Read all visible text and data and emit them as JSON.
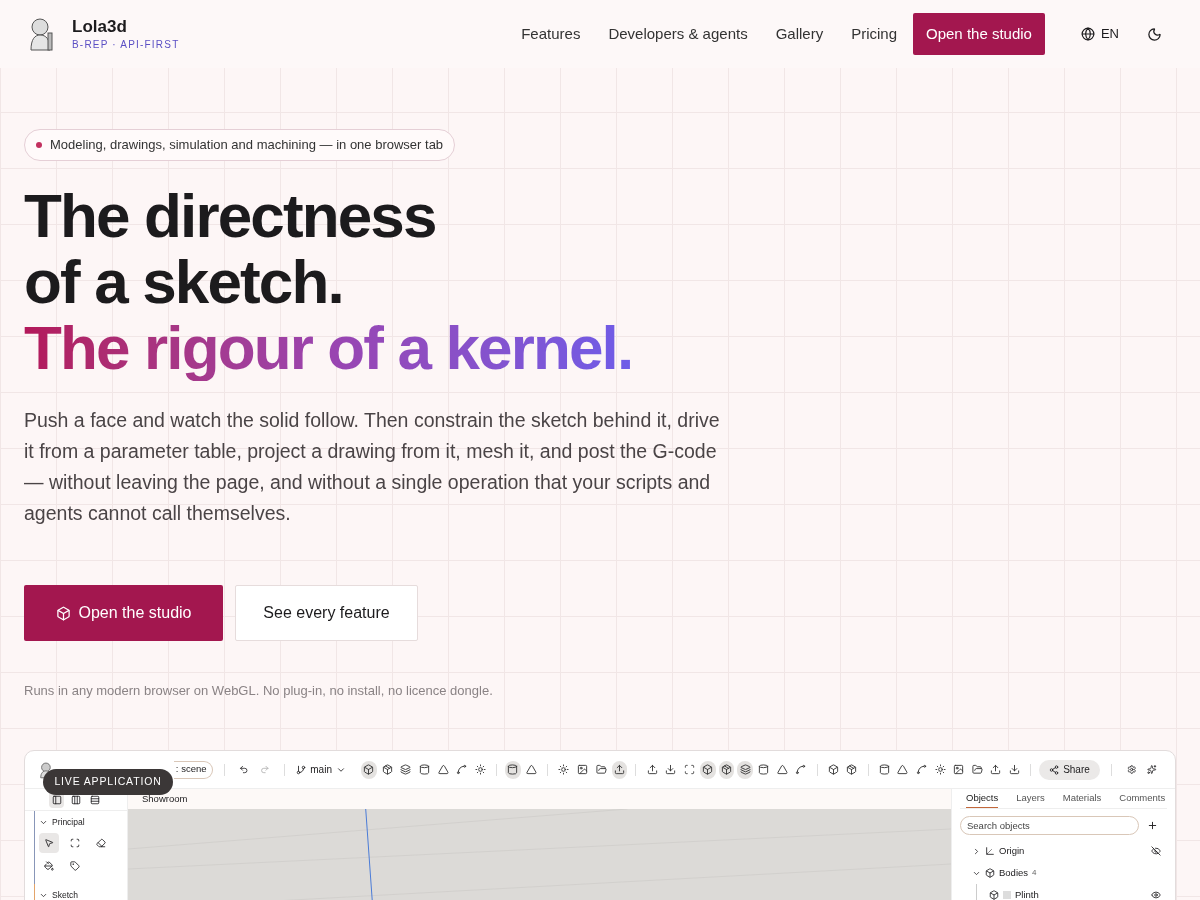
{
  "brand": {
    "name": "Lola3d",
    "tagline": "B-REP · API-FIRST"
  },
  "nav": {
    "links": [
      "Features",
      "Developers & agents",
      "Gallery",
      "Pricing"
    ],
    "cta": "Open the studio",
    "language": "EN"
  },
  "hero": {
    "pill": "Modeling, drawings, simulation and machining — in one browser tab",
    "title_lines": [
      "The directness",
      "of a sketch."
    ],
    "title_accent": "The rigour of a kernel.",
    "body": "Push a face and watch the solid follow. Then constrain the sketch behind it, drive it from a parameter table, project a drawing from it, mesh it, and post the G-code — without leaving the page, and without a single operation that your scripts and agents cannot call themselves.",
    "primary": "Open the studio",
    "secondary": "See every feature",
    "note": "Runs in any modern browser on WebGL. No plug-in, no install, no licence dongle."
  },
  "app": {
    "badge": "LIVE APPLICATION",
    "doc_tab": ": scene",
    "branch": "main",
    "share": "Share",
    "toolbar_groups": [
      [
        {
          "selected": true
        },
        {
          "selected": false
        },
        {
          "selected": false
        },
        {
          "selected": false
        },
        {
          "selected": false
        },
        {
          "selected": false
        },
        {
          "selected": false
        }
      ],
      [
        {
          "selected": true
        },
        {
          "selected": false
        }
      ],
      [
        {
          "selected": false
        },
        {
          "selected": false
        },
        {
          "selected": false
        },
        {
          "selected": true
        }
      ],
      [
        {
          "selected": false
        },
        {
          "selected": false
        },
        {
          "selected": false
        },
        {
          "selected": true
        },
        {
          "selected": true
        },
        {
          "selected": true
        },
        {
          "selected": false
        },
        {
          "selected": false
        },
        {
          "selected": false
        }
      ],
      [
        {
          "selected": false
        },
        {
          "selected": false
        }
      ],
      [
        {
          "selected": false
        },
        {
          "selected": false
        },
        {
          "selected": false
        },
        {
          "selected": false
        },
        {
          "selected": false
        },
        {
          "selected": false
        },
        {
          "selected": false
        },
        {
          "selected": false
        }
      ]
    ],
    "layouts": [
      {
        "selected": true
      },
      {
        "selected": false
      },
      {
        "selected": false
      }
    ],
    "sections": [
      {
        "title": "Principal",
        "tools": [
          {
            "selected": true
          },
          {
            "selected": false
          },
          {
            "selected": false
          },
          {
            "selected": false
          },
          {
            "selected": false
          }
        ]
      },
      {
        "title": "Sketch"
      }
    ],
    "viewport_title": "Showroom",
    "tabs": [
      {
        "label": "Objects",
        "selected": true
      },
      {
        "label": "Layers",
        "selected": false
      },
      {
        "label": "Materials",
        "selected": false
      },
      {
        "label": "Comments",
        "selected": false
      }
    ],
    "search_placeholder": "Search objects",
    "tree": [
      {
        "label": "Origin",
        "kind": "origin",
        "expanded": false,
        "visible": false
      },
      {
        "label": "Bodies",
        "count": "4",
        "kind": "folder",
        "expanded": true,
        "children": [
          {
            "label": "Plinth",
            "kind": "body",
            "visible": true
          }
        ]
      }
    ]
  }
}
